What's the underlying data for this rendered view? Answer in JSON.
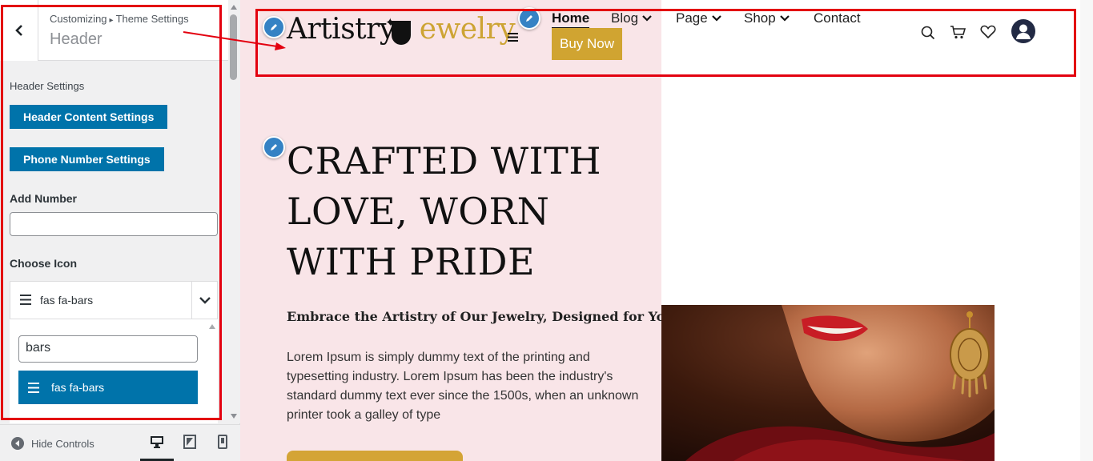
{
  "customizer": {
    "breadcrumb_parent": "Customizing",
    "breadcrumb_sep": "▸",
    "breadcrumb_current": "Theme Settings",
    "section_title": "Header",
    "header_settings_label": "Header Settings",
    "buttons": {
      "header_content": "Header Content Settings",
      "phone_number": "Phone Number Settings"
    },
    "add_number": {
      "label": "Add Number",
      "value": "",
      "placeholder": ""
    },
    "choose_icon": {
      "label": "Choose Icon",
      "selected": "fas fa-bars",
      "search_value": "bars",
      "options": [
        "fas fa-bars"
      ]
    },
    "footer": {
      "hide_controls": "Hide Controls",
      "devices": [
        "desktop",
        "tablet",
        "mobile"
      ],
      "active_device": "desktop"
    }
  },
  "site": {
    "logo_part1": "Artistry",
    "logo_part2": "ewelry",
    "nav": [
      "Home",
      "Blog",
      "Page",
      "Shop",
      "Contact"
    ],
    "nav_dropdowns": [
      "Blog",
      "Page",
      "Shop"
    ],
    "active_nav": "Home",
    "buy_now": "Buy Now",
    "header_icons": [
      "search-icon",
      "cart-icon",
      "heart-icon",
      "user-icon"
    ],
    "hero": {
      "title": "CRAFTED WITH LOVE, WORN WITH PRIDE",
      "subtitle": "Embrace the Artistry of Our Jewelry, Designed for You",
      "body": "Lorem Ipsum is simply dummy text of the printing and typesetting industry. Lorem Ipsum has been the industry's standard dummy text ever since the 1500s, when an unknown printer took a galley of type"
    }
  },
  "colors": {
    "wp_blue": "#0073aa",
    "accent_gold": "#cda434",
    "hero_pink": "#f9e5e8",
    "annotation_red": "#e3000f",
    "edit_pencil_blue": "#3582c4"
  }
}
